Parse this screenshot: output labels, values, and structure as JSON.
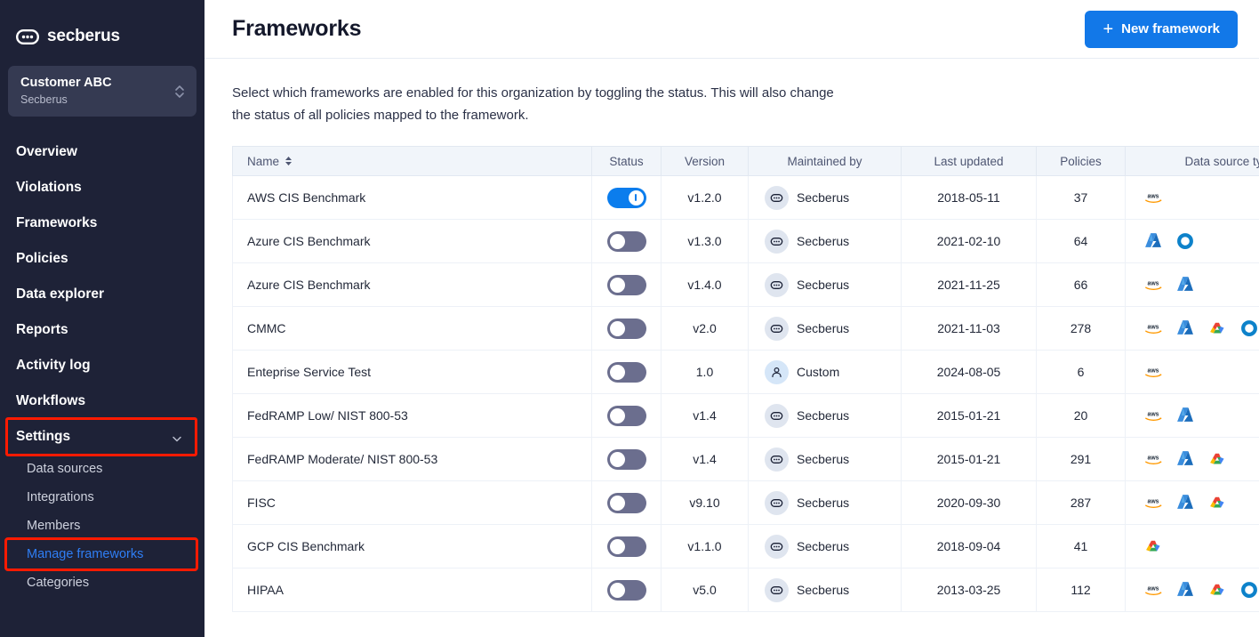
{
  "sidebar": {
    "brand": {
      "name": "secberus",
      "logo_icon": "secberus-logo-icon"
    },
    "org": {
      "name": "Customer ABC",
      "subtitle": "Secberus",
      "chevron_icon": "chevron-updown-icon"
    },
    "nav": [
      {
        "label": "Overview",
        "name": "overview"
      },
      {
        "label": "Violations",
        "name": "violations"
      },
      {
        "label": "Frameworks",
        "name": "frameworks"
      },
      {
        "label": "Policies",
        "name": "policies"
      },
      {
        "label": "Data explorer",
        "name": "data-explorer"
      },
      {
        "label": "Reports",
        "name": "reports"
      },
      {
        "label": "Activity log",
        "name": "activity-log"
      },
      {
        "label": "Workflows",
        "name": "workflows"
      }
    ],
    "settings": {
      "label": "Settings",
      "chevron_icon": "chevron-down-icon",
      "highlighted": true
    },
    "subnav": [
      {
        "label": "Data sources",
        "name": "data-sources",
        "active": false,
        "highlighted": false
      },
      {
        "label": "Integrations",
        "name": "integrations",
        "active": false,
        "highlighted": false
      },
      {
        "label": "Members",
        "name": "members",
        "active": false,
        "highlighted": false
      },
      {
        "label": "Manage frameworks",
        "name": "manage-frameworks",
        "active": true,
        "highlighted": true
      },
      {
        "label": "Categories",
        "name": "categories",
        "active": false,
        "highlighted": false
      }
    ]
  },
  "header": {
    "title": "Frameworks",
    "new_framework_label": "New framework",
    "new_framework_icon": "plus-icon"
  },
  "main": {
    "intro": "Select which frameworks are enabled for this organization by toggling the status. This will also change the status of all policies mapped to the framework."
  },
  "table": {
    "columns": [
      {
        "key": "name",
        "label": "Name",
        "sortable": true,
        "sort_icon": "sort-arrows-icon"
      },
      {
        "key": "status",
        "label": "Status",
        "sortable": false
      },
      {
        "key": "version",
        "label": "Version",
        "sortable": false
      },
      {
        "key": "maintained_by",
        "label": "Maintained by",
        "sortable": false
      },
      {
        "key": "last_updated",
        "label": "Last updated",
        "sortable": false
      },
      {
        "key": "policies",
        "label": "Policies",
        "sortable": false
      },
      {
        "key": "data_source_type",
        "label": "Data source type",
        "sortable": false
      }
    ],
    "rows": [
      {
        "name": "AWS CIS Benchmark",
        "status": true,
        "version": "v1.2.0",
        "maintained_by": "Secberus",
        "maintainer_icon": "secberus-avatar-icon",
        "last_updated": "2018-05-11",
        "policies": "37",
        "data_source_type": [
          "aws"
        ]
      },
      {
        "name": "Azure CIS Benchmark",
        "status": false,
        "version": "v1.3.0",
        "maintained_by": "Secberus",
        "maintainer_icon": "secberus-avatar-icon",
        "last_updated": "2021-02-10",
        "policies": "64",
        "data_source_type": [
          "azure",
          "office365"
        ]
      },
      {
        "name": "Azure CIS Benchmark",
        "status": false,
        "version": "v1.4.0",
        "maintained_by": "Secberus",
        "maintainer_icon": "secberus-avatar-icon",
        "last_updated": "2021-11-25",
        "policies": "66",
        "data_source_type": [
          "aws",
          "azure"
        ]
      },
      {
        "name": "CMMC",
        "status": false,
        "version": "v2.0",
        "maintained_by": "Secberus",
        "maintainer_icon": "secberus-avatar-icon",
        "last_updated": "2021-11-03",
        "policies": "278",
        "data_source_type": [
          "aws",
          "azure",
          "gcp",
          "office365"
        ]
      },
      {
        "name": "Enteprise Service Test",
        "status": false,
        "version": "1.0",
        "maintained_by": "Custom",
        "maintainer_icon": "person-avatar-icon",
        "last_updated": "2024-08-05",
        "policies": "6",
        "data_source_type": [
          "aws"
        ]
      },
      {
        "name": "FedRAMP Low/ NIST 800-53",
        "status": false,
        "version": "v1.4",
        "maintained_by": "Secberus",
        "maintainer_icon": "secberus-avatar-icon",
        "last_updated": "2015-01-21",
        "policies": "20",
        "data_source_type": [
          "aws",
          "azure"
        ]
      },
      {
        "name": "FedRAMP Moderate/ NIST 800-53",
        "status": false,
        "version": "v1.4",
        "maintained_by": "Secberus",
        "maintainer_icon": "secberus-avatar-icon",
        "last_updated": "2015-01-21",
        "policies": "291",
        "data_source_type": [
          "aws",
          "azure",
          "gcp"
        ]
      },
      {
        "name": "FISC",
        "status": false,
        "version": "v9.10",
        "maintained_by": "Secberus",
        "maintainer_icon": "secberus-avatar-icon",
        "last_updated": "2020-09-30",
        "policies": "287",
        "data_source_type": [
          "aws",
          "azure",
          "gcp"
        ]
      },
      {
        "name": "GCP CIS Benchmark",
        "status": false,
        "version": "v1.1.0",
        "maintained_by": "Secberus",
        "maintainer_icon": "secberus-avatar-icon",
        "last_updated": "2018-09-04",
        "policies": "41",
        "data_source_type": [
          "gcp"
        ]
      },
      {
        "name": "HIPAA",
        "status": false,
        "version": "v5.0",
        "maintained_by": "Secberus",
        "maintainer_icon": "secberus-avatar-icon",
        "last_updated": "2013-03-25",
        "policies": "112",
        "data_source_type": [
          "aws",
          "azure",
          "gcp",
          "office365"
        ]
      }
    ]
  },
  "colors": {
    "sidebar_bg": "#1e2237",
    "org_card_bg": "#353a52",
    "accent_blue": "#1278e8",
    "link_blue": "#2f7ef5",
    "highlight_red": "#ff1a00",
    "toggle_on": "#0b7ded",
    "toggle_off": "#6b6e8e",
    "table_header_bg": "#f1f5fa"
  }
}
